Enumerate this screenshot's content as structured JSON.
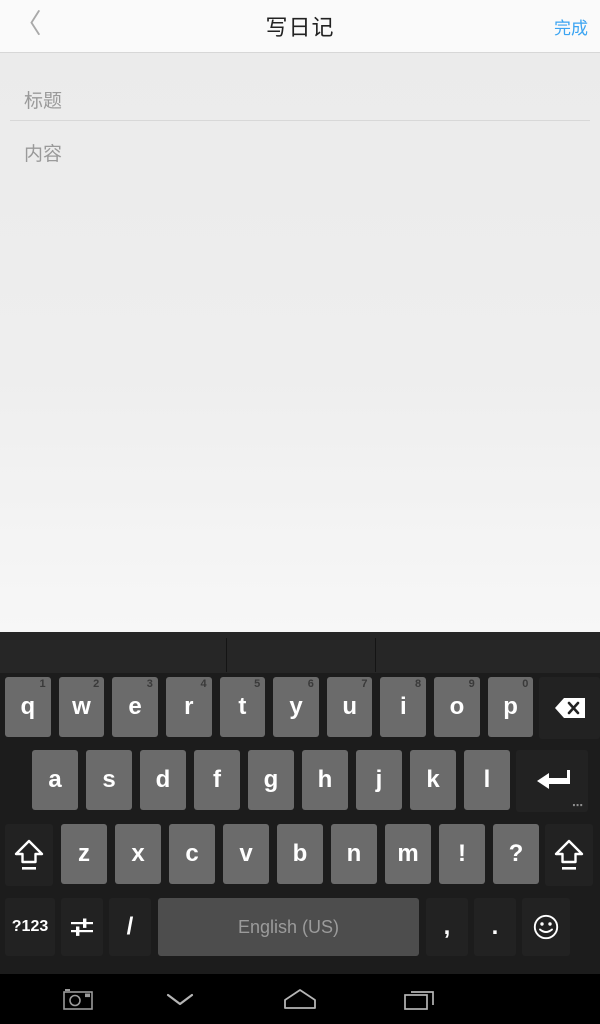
{
  "appbar": {
    "back_icon": "chevron-left-icon",
    "back_glyph": "〈",
    "title": "写日记",
    "done_label": "完成",
    "done_color": "#3ba4f2"
  },
  "editor": {
    "title_field": {
      "value": "",
      "placeholder": "标题"
    },
    "content_field": {
      "value": "",
      "placeholder": "内容"
    }
  },
  "keyboard": {
    "suggestions": [
      "",
      "",
      ""
    ],
    "row1": [
      {
        "label": "q",
        "hint": "1"
      },
      {
        "label": "w",
        "hint": "2"
      },
      {
        "label": "e",
        "hint": "3"
      },
      {
        "label": "r",
        "hint": "4"
      },
      {
        "label": "t",
        "hint": "5"
      },
      {
        "label": "y",
        "hint": "6"
      },
      {
        "label": "u",
        "hint": "7"
      },
      {
        "label": "i",
        "hint": "8"
      },
      {
        "label": "o",
        "hint": "9"
      },
      {
        "label": "p",
        "hint": "0"
      }
    ],
    "backspace_icon": "backspace-icon",
    "row2": [
      {
        "label": "a"
      },
      {
        "label": "s"
      },
      {
        "label": "d"
      },
      {
        "label": "f"
      },
      {
        "label": "g"
      },
      {
        "label": "h"
      },
      {
        "label": "j"
      },
      {
        "label": "k"
      },
      {
        "label": "l"
      }
    ],
    "enter_icon": "enter-icon",
    "enter_more": "⋯",
    "row3": [
      {
        "label": "z"
      },
      {
        "label": "x"
      },
      {
        "label": "c"
      },
      {
        "label": "v"
      },
      {
        "label": "b"
      },
      {
        "label": "n"
      },
      {
        "label": "m"
      },
      {
        "label": "!"
      },
      {
        "label": "?"
      }
    ],
    "shift_left_icon": "shift-icon",
    "shift_right_icon": "shift-icon",
    "symbols_label": "?123",
    "settings_icon": "keyboard-settings-icon",
    "slash_label": "/",
    "space_label": "English (US)",
    "comma_label": ",",
    "period_label": ".",
    "emoji_icon": "emoji-smiley-icon"
  },
  "navbar": {
    "screenshot_icon": "camera-icon",
    "hide_keyboard_icon": "chevron-down-icon",
    "home_icon": "home-icon",
    "recents_icon": "recents-icon"
  }
}
